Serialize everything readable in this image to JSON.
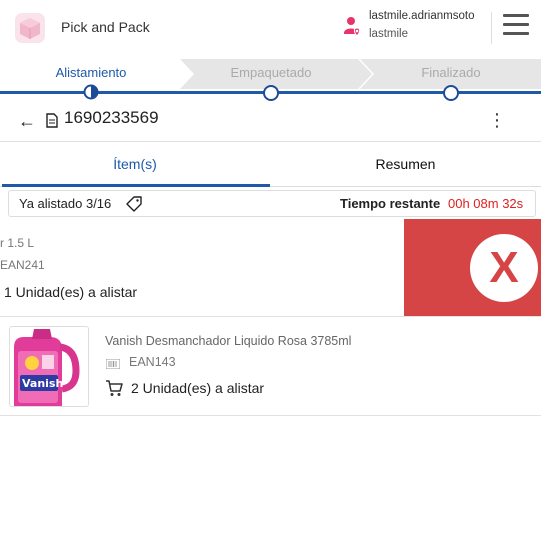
{
  "app": {
    "title": "Pick and Pack"
  },
  "user": {
    "name": "lastmile.adrianmsoto",
    "company": "lastmile"
  },
  "stepper": {
    "steps": [
      {
        "label": "Alistamiento",
        "state": "active"
      },
      {
        "label": "Empaquetado",
        "state": "pending"
      },
      {
        "label": "Finalizado",
        "state": "pending"
      }
    ]
  },
  "order": {
    "number": "1690233569"
  },
  "tabs": {
    "items_label": "Ítem(s)",
    "summary_label": "Resumen",
    "active": "items"
  },
  "progress": {
    "picked_label": "Ya alistado 3/16",
    "time_label": "Tiempo restante",
    "time_value": "00h 08m 32s"
  },
  "items": [
    {
      "name": "r 1.5 L",
      "ean": "EAN241",
      "quantity": "1 Unidad(es) a alistar",
      "delete_symbol": "X"
    },
    {
      "name": "Vanish Desmanchador Liquido Rosa 3785ml",
      "ean": "EAN143",
      "quantity": "2 Unidad(es) a alistar",
      "image_label": "Vanish"
    }
  ],
  "colors": {
    "accent": "#1e5aa8",
    "delete_bg": "#d64545",
    "timer": "#e02020",
    "user_icon": "#e8336b"
  }
}
